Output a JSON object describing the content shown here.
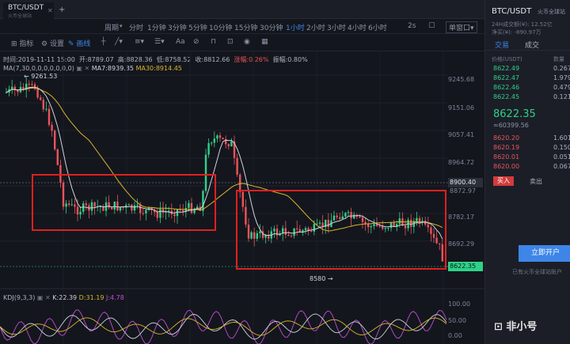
{
  "tab": {
    "pair": "BTC/USDT",
    "exchange": "火币全球站",
    "close": "✕",
    "add": "+"
  },
  "periods": [
    "周期",
    "分时",
    "1分钟",
    "3分钟",
    "5分钟",
    "10分钟",
    "15分钟",
    "30分钟",
    "1小时",
    "2小时",
    "3小时",
    "4小时",
    "6小时"
  ],
  "active_period": "1小时",
  "right_controls": {
    "s2": "2s",
    "single": "单窗口"
  },
  "toolbar": {
    "indicator": "指标",
    "settings": "设置",
    "draw": "画线",
    "font": "Aa"
  },
  "info": {
    "time": "时间:2019-11-11 15:00",
    "open": "开:8789.07",
    "high": "高:8828.36",
    "low": "低:8758.52",
    "close": "收:8812.66",
    "change": "涨幅:0.26%",
    "amp": "振幅:0.80%"
  },
  "ma": {
    "params": "MA(7,30,0,0,0,0,0,0,0)",
    "ma7": "MA7:8939.35",
    "ma30": "MA30:8914.45"
  },
  "price_labels": [
    "9245.68",
    "9151.06",
    "9057.41",
    "8964.72",
    "8900.40",
    "8872.97",
    "8782.17",
    "8692.29",
    "8622.35"
  ],
  "annotations": {
    "high": "9261.53",
    "low": "8580"
  },
  "kdj": {
    "params": "KDJ(9,3,3)",
    "k": "K:22.39",
    "d": "D:31.19",
    "j": "J:4.78"
  },
  "kdj_axis": [
    "100.00",
    "50.00",
    "0.00"
  ],
  "colors": {
    "up": "#2fd189",
    "down": "#e9545b",
    "ma7": "#cfd3dc",
    "ma30": "#d8b530",
    "box": "#e02020",
    "accent": "#3d86e8"
  },
  "right_panel": {
    "pair": "BTC/USDT",
    "exchange": "火币全球站",
    "volume": "24H成交额(¥): 12.52亿",
    "hold": "净买(¥): -890.97万",
    "tabs": [
      "交易",
      "成交"
    ],
    "head_price": "价格(USDT)",
    "head_qty": "数量",
    "asks": [
      {
        "p": "8622.49",
        "q": "0.267"
      },
      {
        "p": "8622.47",
        "q": "1.979"
      },
      {
        "p": "8622.46",
        "q": "0.479"
      },
      {
        "p": "8622.45",
        "q": "0.121"
      }
    ],
    "last": "8622.35",
    "cny": "≈60399.56",
    "bids": [
      {
        "p": "8620.20",
        "q": "1.601"
      },
      {
        "p": "8620.19",
        "q": "0.150"
      },
      {
        "p": "8620.01",
        "q": "0.051"
      },
      {
        "p": "8620.00",
        "q": "0.067"
      }
    ],
    "buy": "买入",
    "sell": "卖出",
    "open_btn": "立即开户",
    "note": "已有火币全球站账户",
    "watermark": "非小号"
  }
}
